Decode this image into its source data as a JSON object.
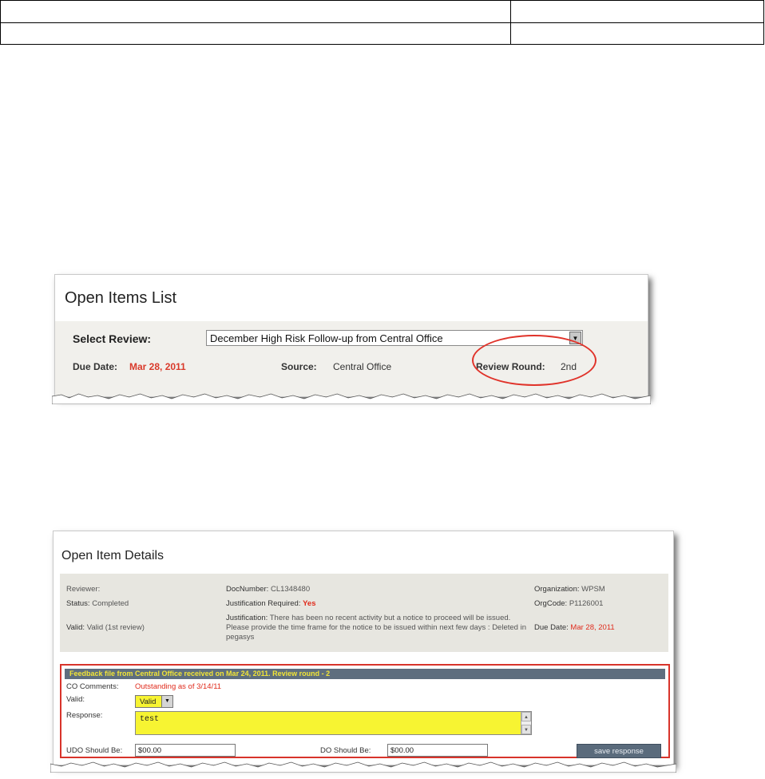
{
  "top_table": {
    "rows": [
      [
        "",
        ""
      ],
      [
        "",
        ""
      ]
    ]
  },
  "open_items_list": {
    "title": "Open Items List",
    "select_review_label": "Select Review:",
    "select_review_value": "December High Risk Follow-up from Central Office",
    "due_date_label": "Due Date:",
    "due_date_value": "Mar 28, 2011",
    "source_label": "Source:",
    "source_value": "Central Office",
    "review_round_label": "Review Round:",
    "review_round_value": "2nd",
    "highlight_color": "#e0332a"
  },
  "open_item_details": {
    "title": "Open Item Details",
    "reviewer_label": "Reviewer:",
    "status_label": "Status:",
    "status_value": "Completed",
    "valid_label": "Valid:",
    "valid_value": "Valid (1st review)",
    "docnumber_label": "DocNumber:",
    "docnumber_value": "CL1348480",
    "justification_required_label": "Justification Required:",
    "justification_required_value": "Yes",
    "justification_label": "Justification:",
    "justification_value": "There has been no recent activity but a notice to proceed will be issued. Please provide the time frame for the notice to be issued within next few days : Deleted in pegasys",
    "organization_label": "Organization:",
    "organization_value": "WPSM",
    "orgcode_label": "OrgCode:",
    "orgcode_value": "P1126001",
    "due_date_label": "Due Date:",
    "due_date_value": "Mar 28, 2011"
  },
  "feedback": {
    "header": "Feedback file from Central Office received on Mar 24, 2011. Review round - 2",
    "co_comments_label": "CO Comments:",
    "co_comments_value": "Outstanding as of 3/14/11",
    "valid_label": "Valid:",
    "valid_selected": "Valid",
    "response_label": "Response:",
    "response_value": "test",
    "udo_label": "UDO Should Be:",
    "udo_value": "$00.00",
    "do_label": "DO Should Be:",
    "do_value": "$00.00",
    "save_button": "save response",
    "highlight_yellow": "#f7f432",
    "border_red": "#d8342b"
  }
}
